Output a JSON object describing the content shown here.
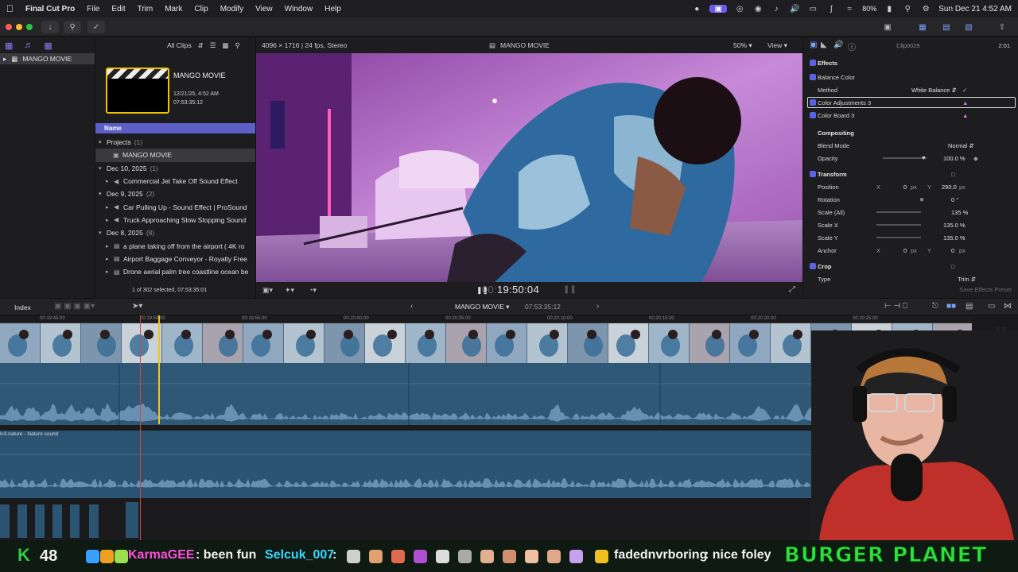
{
  "menubar": {
    "app": "Final Cut Pro",
    "items": [
      "File",
      "Edit",
      "Trim",
      "Mark",
      "Clip",
      "Modify",
      "View",
      "Window",
      "Help"
    ],
    "battery": "80%",
    "datetime": "Sun Dec 21  4:52 AM"
  },
  "browser": {
    "filter": "All Clips",
    "project_name": "MANGO MOVIE",
    "project_date": "12/21/25, 4:52 AM",
    "project_duration": "07:53:35:12",
    "column_name": "Name",
    "groups": [
      {
        "label": "Projects",
        "count": "(1)",
        "items": [
          {
            "label": "MANGO MOVIE",
            "selected": true
          }
        ]
      },
      {
        "label": "Dec 10, 2025",
        "count": "(1)",
        "items": [
          {
            "label": "Commercial Jet Take Off Sound Effect"
          }
        ]
      },
      {
        "label": "Dec 9, 2025",
        "count": "(2)",
        "items": [
          {
            "label": "Car Pulling Up - Sound Effect  |  ProSound"
          },
          {
            "label": "Truck Approaching Slow Stopping Sound"
          }
        ]
      },
      {
        "label": "Dec 8, 2025",
        "count": "(8)",
        "items": [
          {
            "label": "a plane taking off from the airport ( 4K ro"
          },
          {
            "label": "Airport Baggage Conveyor - Royalty Free"
          },
          {
            "label": "Drone aerial palm tree coastline ocean be"
          }
        ]
      }
    ],
    "footer": "1 of 302 selected, 07:53:35:01"
  },
  "sidebar": {
    "library": "MANGO MOVIE"
  },
  "viewer": {
    "format": "4096 × 1716 | 24 fps, Stereo",
    "title": "MANGO MOVIE",
    "zoom": "50%",
    "view": "View",
    "timecode_prefix": "00:",
    "timecode": "19:50:04"
  },
  "inspector": {
    "clip": "Clip0029",
    "duration": "2:01",
    "effects": "Effects",
    "balance_color": "Balance Color",
    "method_label": "Method",
    "method_value": "White Balance",
    "color_adjustments": "Color Adjustments 3",
    "color_board": "Color Board 3",
    "compositing": "Compositing",
    "blend_mode_label": "Blend Mode",
    "blend_mode_value": "Normal",
    "opacity_label": "Opacity",
    "opacity_value": "100.0 %",
    "opacity_level": 1.0,
    "transform": "Transform",
    "position_label": "Position",
    "position_x": "0",
    "position_y": "290.0",
    "rotation_label": "Rotation",
    "rotation_value": "0 °",
    "scale_all_label": "Scale (All)",
    "scale_all_value": "135 %",
    "scale_x_label": "Scale X",
    "scale_x_value": "135.0 %",
    "scale_y_label": "Scale Y",
    "scale_y_value": "135.0 %",
    "anchor_label": "Anchor",
    "anchor_x": "0",
    "anchor_y": "0",
    "crop": "Crop",
    "type_label": "Type",
    "type_value": "Trim",
    "save_preset": "Save Effects Preset",
    "unit_px": "px",
    "axis_x": "X",
    "axis_y": "Y"
  },
  "timeline": {
    "index": "Index",
    "name": "MANGO MOVIE",
    "timecode": "07:53:35:12",
    "ruler": [
      "00:19:45:00",
      "00:19:50:00",
      "00:19:55:00",
      "00:20:00:00",
      "00:20:05:00",
      "00:20:10:00",
      "00:20:15:00",
      "00:20:20:00",
      "00:20:25:00"
    ],
    "audio_clip": "lv3.nature - Nature sound"
  },
  "overlay": {
    "k_count": "48",
    "chat": [
      {
        "user": "KarmaGEE",
        "message": ": been fun",
        "color": "#ff4fd8"
      },
      {
        "user": "Selcuk_007",
        "message": " :",
        "color": "#36d7ff"
      },
      {
        "user": "fadednvrboring",
        "message": ": nice foley",
        "color": "#f0f0f0"
      }
    ],
    "brand": "BURGER PLANET"
  },
  "colors": {
    "accent": "#5c5fc6",
    "playhead": "#f3c322",
    "clip_audio": "#2e5876"
  }
}
